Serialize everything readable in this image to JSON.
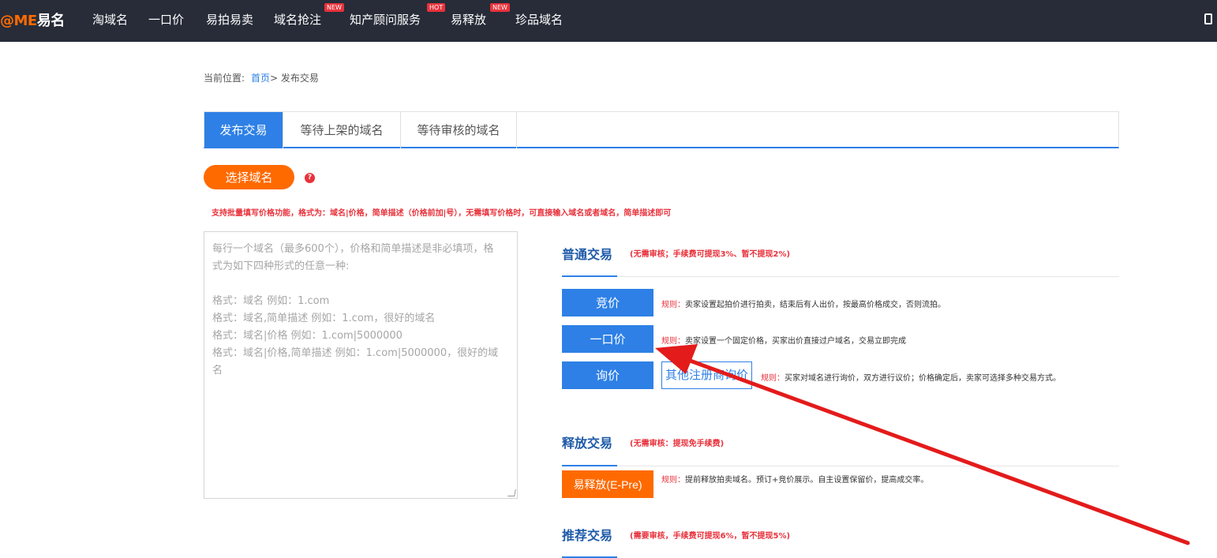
{
  "nav": {
    "logo_prefix": "@ME",
    "logo_suffix": "易名",
    "items": [
      {
        "label": "淘域名",
        "badge": ""
      },
      {
        "label": "一口价",
        "badge": ""
      },
      {
        "label": "易拍易卖",
        "badge": ""
      },
      {
        "label": "域名抢注",
        "badge": "NEW"
      },
      {
        "label": "知产顾问服务",
        "badge": "HOT"
      },
      {
        "label": "易释放",
        "badge": "NEW"
      },
      {
        "label": "珍品域名",
        "badge": ""
      }
    ],
    "right_icon": "phone-icon"
  },
  "breadcrumb": {
    "prefix": "当前位置:",
    "home": "首页",
    "current": "> 发布交易"
  },
  "tabs": [
    "发布交易",
    "等待上架的域名",
    "等待审核的域名"
  ],
  "select_button": "选择域名",
  "help_icon": "?",
  "hint": "支持批量填写价格功能，格式为：域名|价格，简单描述（价格前加|号），无需填写价格时，可直接输入域名或者域名，简单描述即可",
  "textarea_placeholder": [
    "每行一个域名（最多600个），价格和简单描述是非必填项，格",
    "式为如下四种形式的任意一种:",
    "",
    "格式：域名 例如：1.com",
    "格式：域名,简单描述 例如：1.com，很好的域名",
    "格式：域名|价格 例如：1.com|5000000",
    "格式：域名|价格,简单描述 例如：1.com|5000000，很好的域",
    "名"
  ],
  "sections": {
    "normal": {
      "title": "普通交易",
      "note": "(无需审核；手续费可提现3%、暂不提现2%)"
    },
    "release": {
      "title": "释放交易",
      "note": "(无需审核：提现免手续费)"
    },
    "recommend": {
      "title": "推荐交易",
      "note": "(需要审核，手续费可提现6%，暂不提现5%)"
    }
  },
  "rule_label": "规则：",
  "buttons": {
    "auction": {
      "label": "竞价",
      "rule": "卖家设置起拍价进行拍卖，结束后有人出价，按最高价格成交，否则流拍。"
    },
    "fixed": {
      "label": "一口价",
      "rule": "卖家设置一个固定价格，买家出价直接过户域名，交易立即完成"
    },
    "inquiry": {
      "label": "询价",
      "rule": "买家对域名进行询价，双方进行议价；价格确定后，卖家可选择多种交易方式。"
    },
    "other": {
      "label": "其他注册商询价"
    },
    "epre": {
      "label": "易释放(E-Pre)",
      "rule": "提前释放拍卖域名。预订+竞价展示。自主设置保留价，提高成交率。"
    }
  },
  "colors": {
    "nav_bg": "#272c38",
    "accent": "#2e80e6",
    "orange": "#ff6a00",
    "red": "#e8323c"
  }
}
